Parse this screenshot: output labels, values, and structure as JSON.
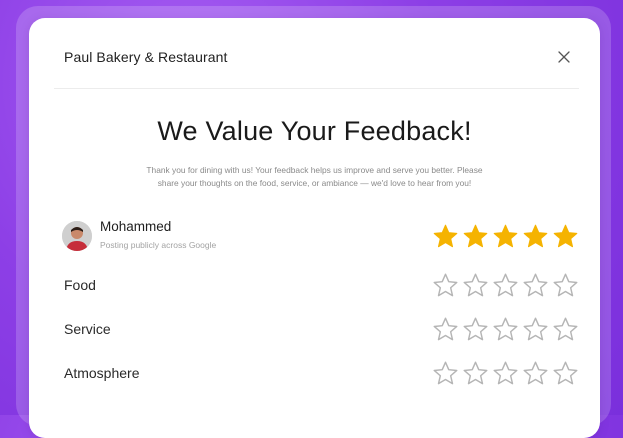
{
  "header": {
    "title": "Paul Bakery & Restaurant"
  },
  "main": {
    "title": "We Value Your Feedback!",
    "subtitle_line1": "Thank you for dining with us! Your feedback helps us improve and serve you better. Please",
    "subtitle_line2": "share your thoughts on the food, service, or ambiance — we'd love to hear from you!"
  },
  "user": {
    "name": "Mohammed",
    "subtitle": "Posting publicly across Google"
  },
  "overall_rating": {
    "value": 5,
    "max": 5
  },
  "categories": [
    {
      "label": "Food",
      "rating": 0,
      "max": 5
    },
    {
      "label": "Service",
      "rating": 0,
      "max": 5
    },
    {
      "label": "Atmosphere",
      "rating": 0,
      "max": 5
    }
  ],
  "colors": {
    "background": "#8d3fe6",
    "star_filled": "#f5b301",
    "star_outline": "#b5b5b5",
    "text": "#1a1a1a"
  },
  "icons": {
    "close": "close-icon",
    "star": "star-icon"
  }
}
